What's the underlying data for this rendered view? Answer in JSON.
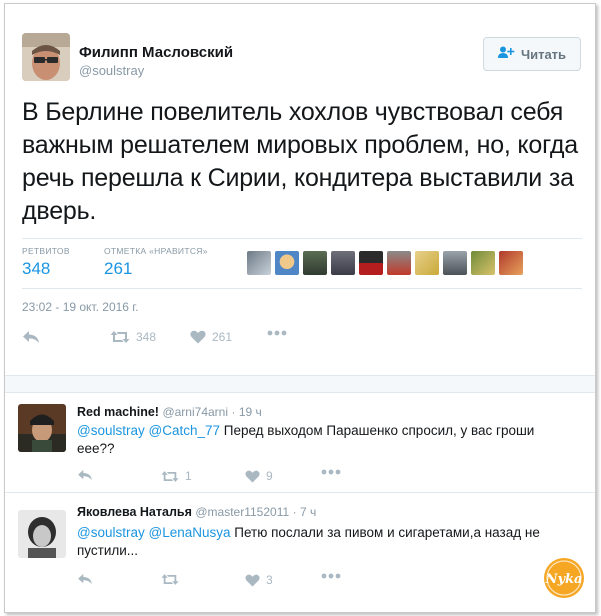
{
  "tweet": {
    "author_name": "Филипп Масловский",
    "author_handle": "@soulstray",
    "follow_label": "Читать",
    "text": "В Берлине повелитель хохлов чувствовал себя важным решателем мировых проблем, но, когда речь перешла к Сирии, кондитера выставили за дверь.",
    "retweets_label": "РЕТВИТОВ",
    "retweets_count": "348",
    "likes_label": "ОТМЕТКА «НРАВИТСЯ»",
    "likes_count": "261",
    "timestamp": "23:02 - 19 окт. 2016 г.",
    "actions": {
      "retweet_count": "348",
      "like_count": "261"
    }
  },
  "replies": [
    {
      "name": "Red machine!",
      "handle": "@arni74arni",
      "time": "· 19 ч",
      "mention1": "@soulstray",
      "mention2": "@Catch_77",
      "text": " Перед выходом  Парашенко спросил, у вас гроши еее??",
      "retweet_count": "1",
      "like_count": "9"
    },
    {
      "name": "Яковлева Наталья",
      "handle": "@master1152011",
      "time": "· 7 ч",
      "mention1": "@soulstray",
      "mention2": "@LenaNusya",
      "text": " Петю послали за пивом и сигаретами,а назад не пустили...",
      "retweet_count": "",
      "like_count": "3"
    }
  ],
  "watermark_text": "Nyka",
  "icons": [
    "follow-person-icon",
    "reply-icon",
    "retweet-icon",
    "heart-icon",
    "more-icon"
  ],
  "colors": {
    "link": "#1b95e0",
    "muted": "#8899a6",
    "icon": "#aab8c2"
  }
}
